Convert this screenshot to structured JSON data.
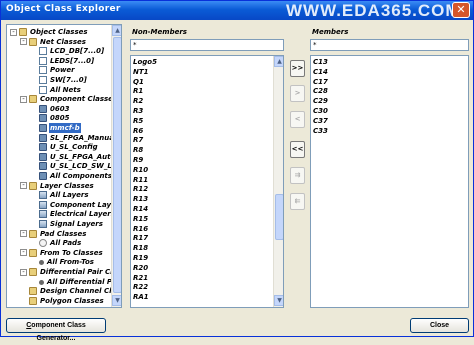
{
  "window": {
    "title": "Object Class Explorer",
    "watermark": "WWW.EDA365.COM",
    "close_glyph": "✕"
  },
  "tree": [
    {
      "label": "Object Classes",
      "icon": "folder-icon",
      "depth": 0,
      "expander": "-"
    },
    {
      "label": "Net Classes",
      "icon": "folder-icon",
      "depth": 1,
      "expander": "-"
    },
    {
      "label": "LCD_DB[7...0]",
      "icon": "net-class-icon",
      "depth": 2
    },
    {
      "label": "LEDS[7...0]",
      "icon": "net-class-icon",
      "depth": 2
    },
    {
      "label": "Power",
      "icon": "net-class-icon",
      "depth": 2
    },
    {
      "label": "SW[7...0]",
      "icon": "net-class-icon",
      "depth": 2
    },
    {
      "label": "All Nets",
      "icon": "net-class-icon",
      "depth": 2
    },
    {
      "label": "Component Classes",
      "icon": "folder-icon",
      "depth": 1,
      "expander": "-"
    },
    {
      "label": "0603",
      "icon": "component-class-icon",
      "depth": 2
    },
    {
      "label": "0805",
      "icon": "component-class-icon",
      "depth": 2
    },
    {
      "label": "mmcf-b",
      "icon": "component-class-icon",
      "depth": 2,
      "selected": true
    },
    {
      "label": "SL_FPGA_Manua",
      "icon": "component-class-icon",
      "depth": 2
    },
    {
      "label": "U_SL_Config",
      "icon": "component-class-icon",
      "depth": 2
    },
    {
      "label": "U_SL_FPGA_Auto",
      "icon": "component-class-icon",
      "depth": 2
    },
    {
      "label": "U_SL_LCD_SW_Li",
      "icon": "component-class-icon",
      "depth": 2
    },
    {
      "label": "All Components",
      "icon": "component-class-icon",
      "depth": 2
    },
    {
      "label": "Layer Classes",
      "icon": "folder-icon",
      "depth": 1,
      "expander": "-"
    },
    {
      "label": "All Layers",
      "icon": "layer-class-icon",
      "depth": 2
    },
    {
      "label": "Component Layer",
      "icon": "layer-class-icon",
      "depth": 2
    },
    {
      "label": "Electrical Layers",
      "icon": "layer-class-icon",
      "depth": 2
    },
    {
      "label": "Signal Layers",
      "icon": "layer-class-icon",
      "depth": 2
    },
    {
      "label": "Pad Classes",
      "icon": "folder-icon",
      "depth": 1,
      "expander": "-"
    },
    {
      "label": "All Pads",
      "icon": "pad-class-icon",
      "depth": 2
    },
    {
      "label": "From To Classes",
      "icon": "folder-icon",
      "depth": 1,
      "expander": "-"
    },
    {
      "label": "All From-Tos",
      "icon": "from-to-class-icon",
      "depth": 2
    },
    {
      "label": "Differential Pair Cla",
      "icon": "folder-icon",
      "depth": 1,
      "expander": "-"
    },
    {
      "label": "All Differential Pa",
      "icon": "from-to-class-icon",
      "depth": 2
    },
    {
      "label": "Design Channel Clas",
      "icon": "folder-icon",
      "depth": 1
    },
    {
      "label": "Polygon Classes",
      "icon": "folder-icon",
      "depth": 1
    }
  ],
  "non_members": {
    "header": "Non-Members",
    "filter_value": "*",
    "items": [
      "Logo5",
      "NT1",
      "Q1",
      "R1",
      "R2",
      "R3",
      "R5",
      "R6",
      "R7",
      "R8",
      "R9",
      "R10",
      "R11",
      "R12",
      "R13",
      "R14",
      "R15",
      "R16",
      "R17",
      "R18",
      "R19",
      "R20",
      "R21",
      "R22",
      "RA1"
    ]
  },
  "members": {
    "header": "Members",
    "filter_value": "*",
    "items": [
      "C13",
      "C14",
      "C17",
      "C28",
      "C29",
      "C30",
      "C37",
      "C33"
    ]
  },
  "move_buttons": [
    {
      "name": "move-all-to-members-button",
      "label": ">>",
      "enabled": true
    },
    {
      "name": "move-selected-to-members-button",
      "label": ">",
      "enabled": false
    },
    {
      "name": "move-selected-to-non-members-button",
      "label": "<",
      "enabled": false
    },
    {
      "name": "move-all-to-non-members-button",
      "label": "<<",
      "enabled": true
    },
    {
      "name": "move-up-button",
      "label": "⇉",
      "enabled": false
    },
    {
      "name": "move-down-button",
      "label": "⇇",
      "enabled": false
    }
  ],
  "buttons": {
    "generator_prefix": "C",
    "generator_rest": "omponent Class Generator...",
    "close": "Close"
  }
}
